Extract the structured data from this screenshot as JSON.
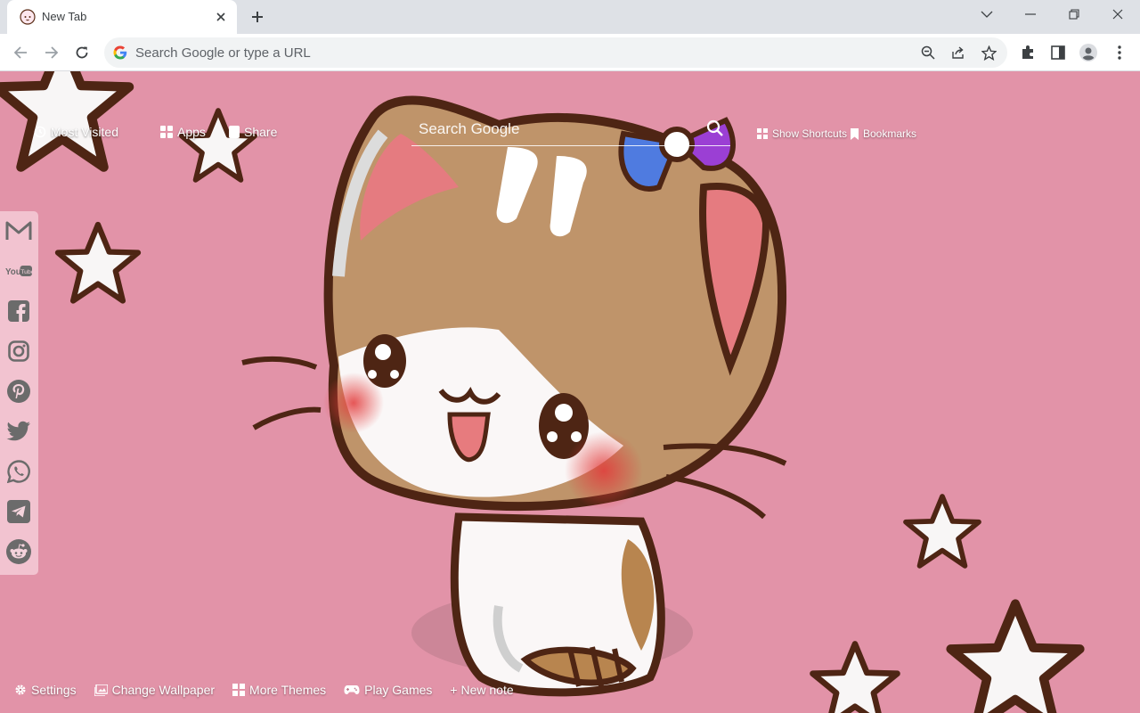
{
  "browser": {
    "tab_title": "New Tab",
    "omnibox_placeholder": "Search Google or type a URL"
  },
  "ntp": {
    "top_links": {
      "most_visited": "Most Visited",
      "apps": "Apps",
      "share": "Share",
      "show_shortcuts": "Show Shortcuts",
      "bookmarks": "Bookmarks"
    },
    "search_placeholder": "Search Google",
    "social_icons": [
      "gmail-icon",
      "youtube-icon",
      "facebook-icon",
      "instagram-icon",
      "pinterest-icon",
      "twitter-icon",
      "whatsapp-icon",
      "telegram-icon",
      "reddit-icon"
    ],
    "bottom_links": {
      "settings": "Settings",
      "change_wallpaper": "Change Wallpaper",
      "more_themes": "More Themes",
      "play_games": "Play Games",
      "new_note": "+ New note"
    }
  },
  "colors": {
    "background": "#e293a8",
    "cat_brown": "#bf946a",
    "outline": "#5a2c16"
  }
}
